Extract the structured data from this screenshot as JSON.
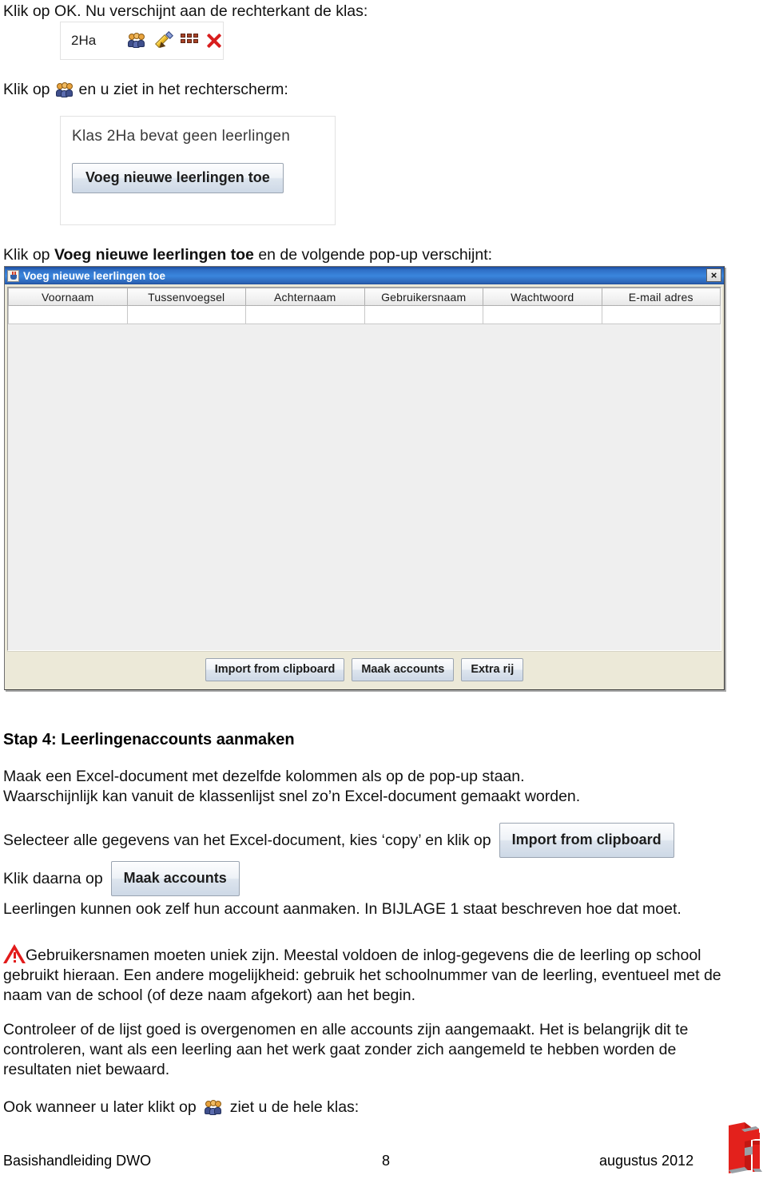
{
  "document": {
    "intro_line": "Klik op OK. Nu verschijnt aan de rechterkant de klas:",
    "klik_op_prefix": "Klik op",
    "klik_op_suffix": "en u ziet in het rechterscherm:",
    "caption_popup_prefix": "Klik op",
    "caption_popup_bold": "Voeg nieuwe leerlingen toe",
    "caption_popup_suffix": "en de volgende pop-up verschijnt:"
  },
  "class_strip": {
    "class_name": "2Ha",
    "icons": [
      "group-icon",
      "pencil-icon",
      "bricks-icon",
      "delete-x-icon"
    ]
  },
  "empty_class_panel": {
    "message": "Klas 2Ha bevat geen leerlingen",
    "button_label": "Voeg nieuwe leerlingen toe"
  },
  "popup": {
    "title": "Voeg nieuwe leerlingen toe",
    "close_label": "×",
    "columns": [
      "Voornaam",
      "Tussenvoegsel",
      "Achternaam",
      "Gebruikersnaam",
      "Wachtwoord",
      "E-mail adres"
    ],
    "rows": [
      [
        "",
        "",
        "",
        "",
        "",
        ""
      ]
    ],
    "buttons": [
      "Import from clipboard",
      "Maak accounts",
      "Extra rij"
    ]
  },
  "step4": {
    "heading": "Stap 4: Leerlingenaccounts aanmaken",
    "paragraph_1_line_1": "Maak een Excel-document met dezelfde kolommen als op de pop-up staan.",
    "paragraph_1_line_2": "Waarschijnlijk kan vanuit de klassenlijst snel zo’n Excel-document gemaakt worden.",
    "select_line": "Selecteer alle gegevens van het Excel-document, kies ‘copy’ en klik op",
    "select_button": "Import from clipboard",
    "then_line": "Klik daarna op",
    "then_button": "Maak accounts",
    "self_account_line": "Leerlingen kunnen ook zelf hun account aanmaken. In BIJLAGE 1 staat beschreven hoe dat moet.",
    "warning_text": "Gebruikersnamen moeten uniek zijn. Meestal voldoen de inlog-gegevens die de leerling op school gebruikt hieraan. Een andere mogelijkheid: gebruik het schoolnummer van de leerling, eventueel met de naam van de school (of deze naam afgekort) aan het begin.",
    "check_text": "Controleer of de lijst goed is overgenomen en alle accounts zijn aangemaakt. Het is belangrijk dit te controleren, want als een leerling aan het werk gaat zonder zich aangemeld te hebben worden de resultaten niet bewaard.",
    "later_line_prefix": "Ook wanneer u later klikt op",
    "later_line_suffix": "ziet u de hele klas:"
  },
  "footer": {
    "left": "Basishandleiding DWO",
    "page": "8",
    "right": "augustus 2012"
  },
  "colors": {
    "warning_red": "#e21b1b",
    "titlebar_blue": "#2f6fc6",
    "logo_red": "#e3211c",
    "delete_x_red": "#d81e1e"
  }
}
